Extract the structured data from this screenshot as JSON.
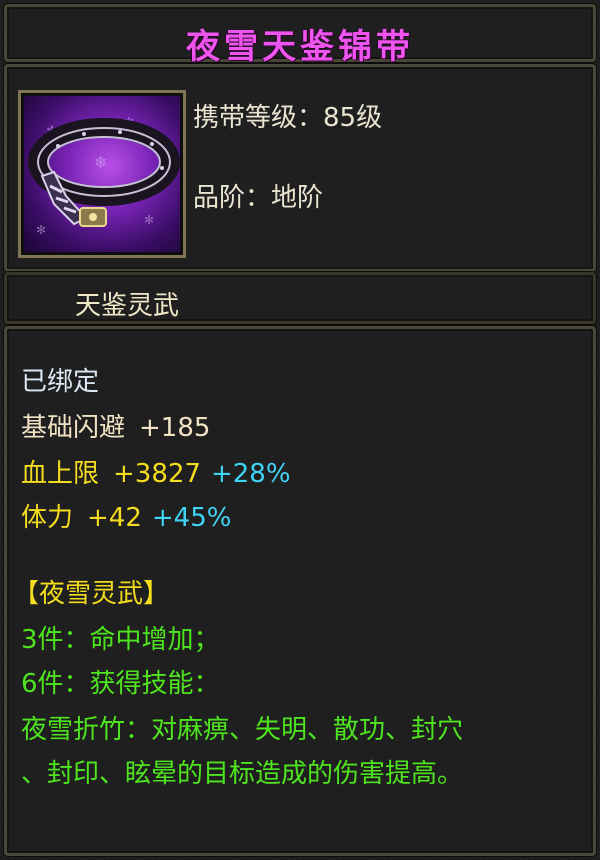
{
  "item": {
    "name": "夜雪天鉴锦带",
    "level_label": "携带等级：85级",
    "grade_label": "品阶：地阶",
    "category": "天鉴灵武",
    "icon": "purple-belt-icon",
    "name_color": "#ee55ee"
  },
  "status": "已绑定",
  "stats": {
    "dodge": {
      "label": "基础闪避",
      "value": "+185"
    },
    "hp": {
      "label": "血上限",
      "value": "+3827",
      "percent": "+28%"
    },
    "stamina": {
      "label": "体力",
      "value": "+42",
      "percent": "+45%"
    }
  },
  "set": {
    "name": "【夜雪灵武】",
    "bonus3": "3件：命中增加；",
    "bonus6": "6件：获得技能：",
    "skill_line1": "夜雪折竹：对麻痹、失明、散功、封穴",
    "skill_line2": "、封印、眩晕的目标造成的伤害提高。"
  }
}
